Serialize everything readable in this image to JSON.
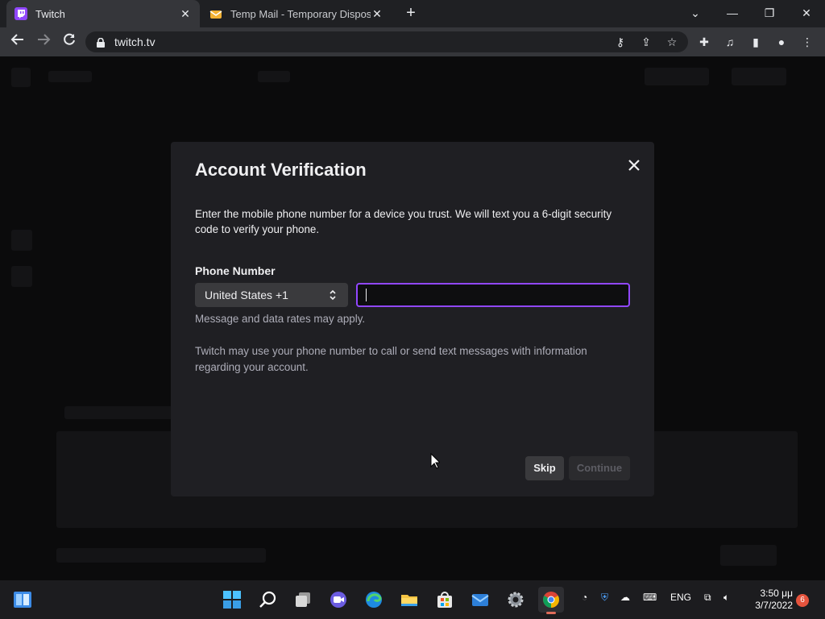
{
  "browser": {
    "tabs": [
      {
        "title": "Twitch",
        "favicon": "twitch-icon",
        "active": true
      },
      {
        "title": "Temp Mail - Temporary Disposab",
        "favicon": "temp-mail-icon",
        "active": false
      }
    ],
    "url": "twitch.tv",
    "colors": {
      "tabbar": "#1f2023",
      "toolbar": "#35363a",
      "omnibox": "#202124"
    }
  },
  "modal": {
    "title": "Account Verification",
    "description": "Enter the mobile phone number for a device you trust. We will text you a 6-digit security code to verify your phone.",
    "phone_label": "Phone Number",
    "country_value": "United States +1",
    "phone_value": "",
    "hint": "Message and data rates may apply.",
    "note": "Twitch may use your phone number to call or send text messages with information regarding your account.",
    "skip_label": "Skip",
    "continue_label": "Continue",
    "colors": {
      "background": "#1f1f23",
      "focus_border": "#9147ff"
    }
  },
  "taskbar": {
    "apps": [
      "start-icon",
      "search-icon",
      "task-view-icon",
      "chat-icon",
      "edge-icon",
      "file-explorer-icon",
      "store-icon",
      "mail-icon",
      "settings-icon",
      "chrome-icon"
    ],
    "language": "ENG",
    "time": "3:50 μμ",
    "date": "3/7/2022",
    "notification_count": "6"
  }
}
